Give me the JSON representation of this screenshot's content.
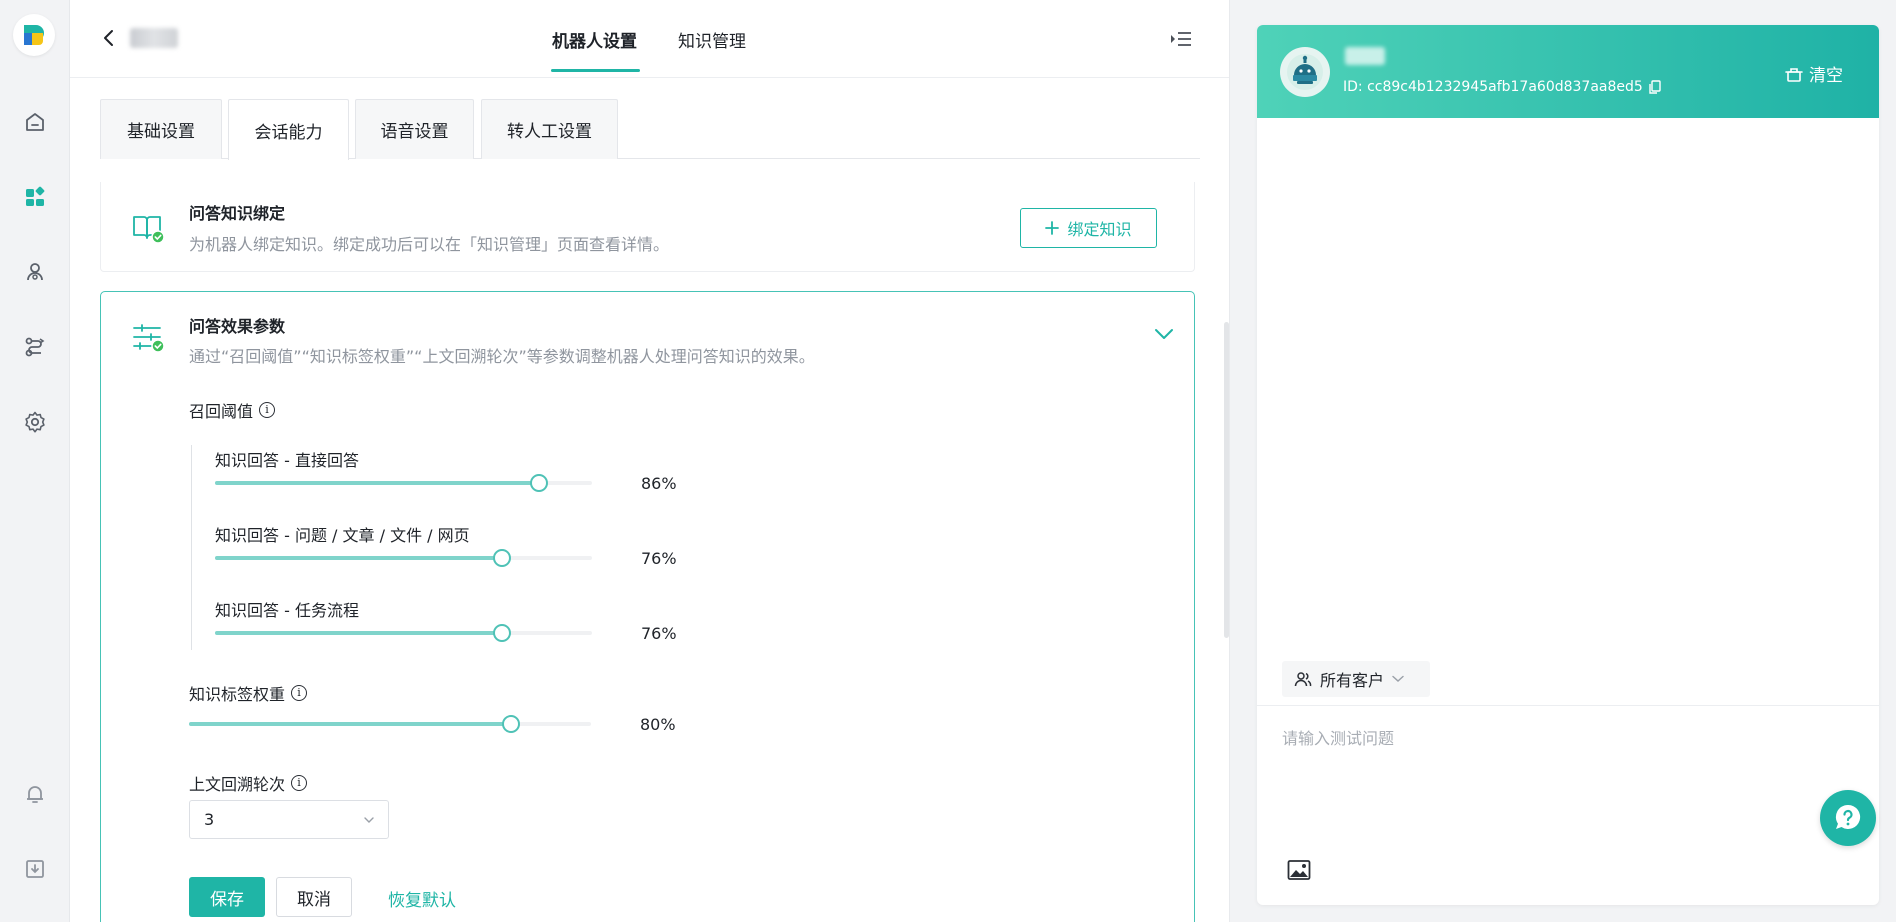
{
  "top_tabs": [
    {
      "label": "机器人设置",
      "active": true
    },
    {
      "label": "知识管理",
      "active": false
    }
  ],
  "sub_tabs": [
    {
      "label": "基础设置",
      "active": false
    },
    {
      "label": "会话能力",
      "active": true
    },
    {
      "label": "语音设置",
      "active": false
    },
    {
      "label": "转人工设置",
      "active": false
    }
  ],
  "knowledge_binding": {
    "title": "问答知识绑定",
    "description": "为机器人绑定知识。绑定成功后可以在「知识管理」页面查看详情。",
    "button_label": "绑定知识"
  },
  "qa_params": {
    "title": "问答效果参数",
    "description": "通过“召回阈值”“知识标签权重”“上文回溯轮次”等参数调整机器人处理问答知识的效果。",
    "recall_threshold": {
      "label": "召回阈值",
      "items": [
        {
          "label": "知识回答 - 直接回答",
          "value": 86,
          "value_text": "86%"
        },
        {
          "label": "知识回答 - 问题 / 文章 / 文件 / 网页",
          "value": 76,
          "value_text": "76%"
        },
        {
          "label": "知识回答 - 任务流程",
          "value": 76,
          "value_text": "76%"
        }
      ]
    },
    "tag_weight": {
      "label": "知识标签权重",
      "value": 80,
      "value_text": "80%"
    },
    "context_rounds": {
      "label": "上文回溯轮次",
      "value": "3"
    },
    "save_label": "保存",
    "cancel_label": "取消",
    "reset_label": "恢复默认"
  },
  "chat": {
    "bot_id": "ID: cc89c4b1232945afb17a60d837aa8ed5",
    "clear_label": "清空",
    "customer_filter": "所有客户",
    "input_placeholder": "请输入测试问题"
  },
  "colors": {
    "accent": "#1fb5a6",
    "slider_fill": "#7fd4cb",
    "header_gradient_start": "#4fd2b8",
    "header_gradient_end": "#1fb2a6",
    "check_green": "#3fbf5b"
  }
}
